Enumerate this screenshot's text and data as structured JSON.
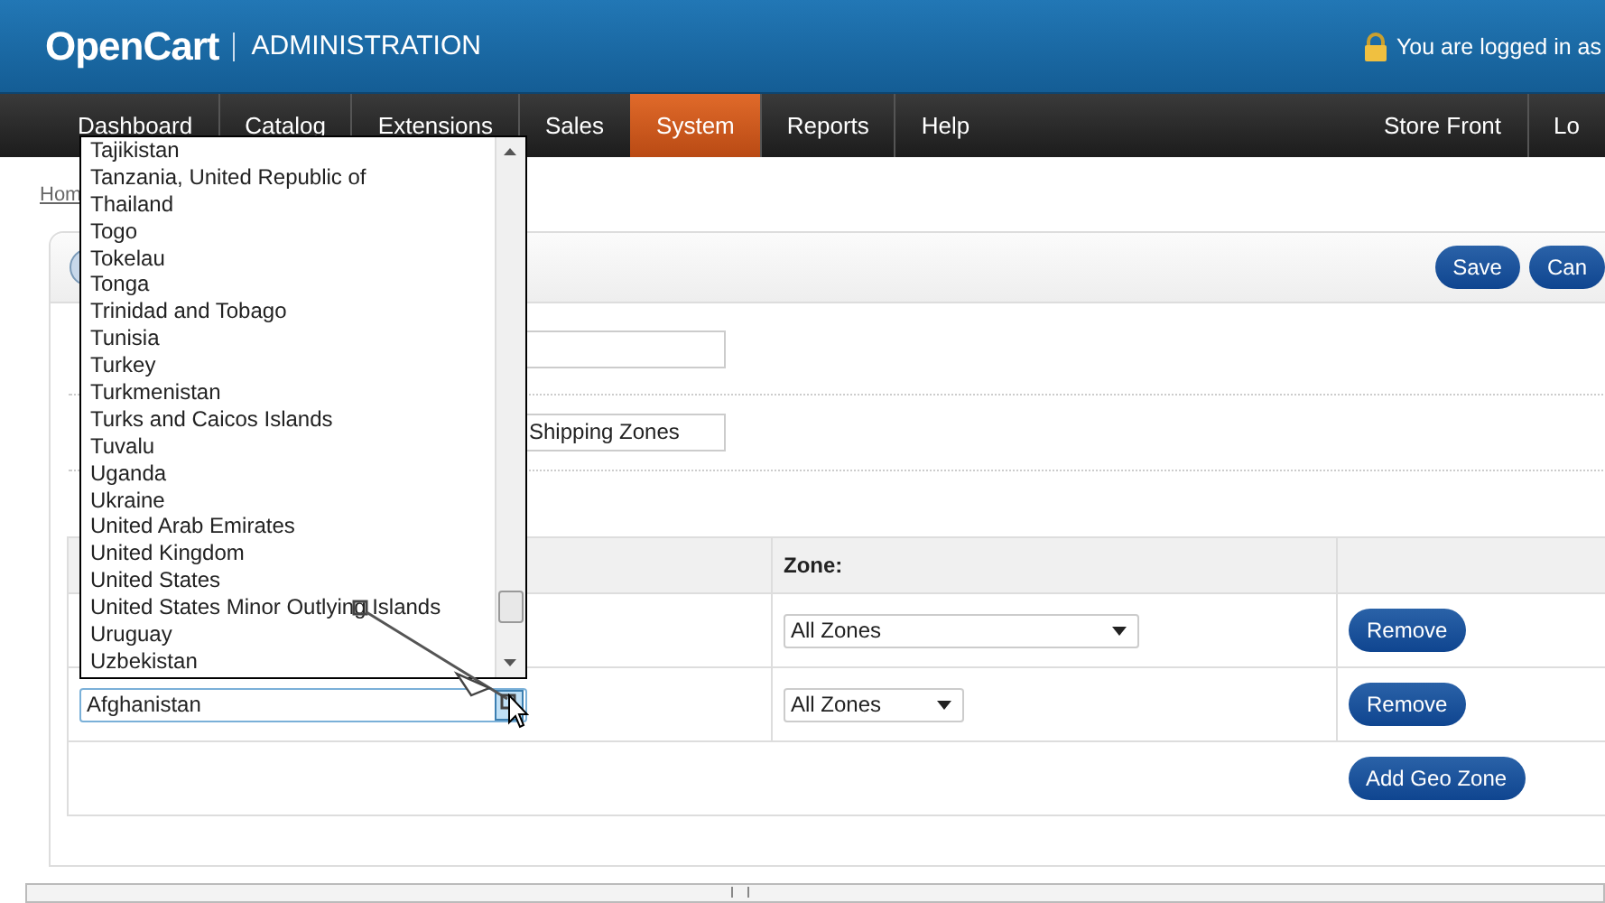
{
  "header": {
    "logo": "OpenCart",
    "subtitle": "ADMINISTRATION",
    "login_text": "You are logged in as"
  },
  "nav": {
    "items": [
      {
        "label": "Dashboard",
        "selected": false
      },
      {
        "label": "Catalog",
        "selected": false
      },
      {
        "label": "Extensions",
        "selected": false
      },
      {
        "label": "Sales",
        "selected": false
      },
      {
        "label": "System",
        "selected": true
      },
      {
        "label": "Reports",
        "selected": false
      },
      {
        "label": "Help",
        "selected": false
      }
    ],
    "right_items": [
      "Store Front",
      "Lo"
    ]
  },
  "breadcrumb": [
    "Hom"
  ],
  "panel": {
    "buttons": [
      "Save",
      "Can"
    ],
    "fields": [
      {
        "kind": "text"
      },
      {
        "kind": "text",
        "value": "Shipping Zones"
      }
    ]
  },
  "table": {
    "columns": [
      "Zone:"
    ],
    "rows": [
      {
        "zone": {
          "value": "All Zones",
          "kind": "wide"
        },
        "action": "Remove"
      },
      {
        "country": {
          "value": "Afghanistan",
          "focused": true
        },
        "zone": {
          "value": "All Zones",
          "kind": "compact"
        },
        "action": "Remove"
      }
    ],
    "add_button": "Add Geo Zone"
  },
  "dropdown": {
    "items": [
      "Tajikistan",
      "Tanzania, United Republic of",
      "Thailand",
      "Togo",
      "Tokelau",
      "Tonga",
      "Trinidad and Tobago",
      "Tunisia",
      "Turkey",
      "Turkmenistan",
      "Turks and Caicos Islands",
      "Tuvalu",
      "Uganda",
      "Ukraine",
      "United Arab Emirates",
      "United Kingdom",
      "United States",
      "United States Minor Outlying Islands",
      "Uruguay",
      "Uzbekistan"
    ]
  }
}
